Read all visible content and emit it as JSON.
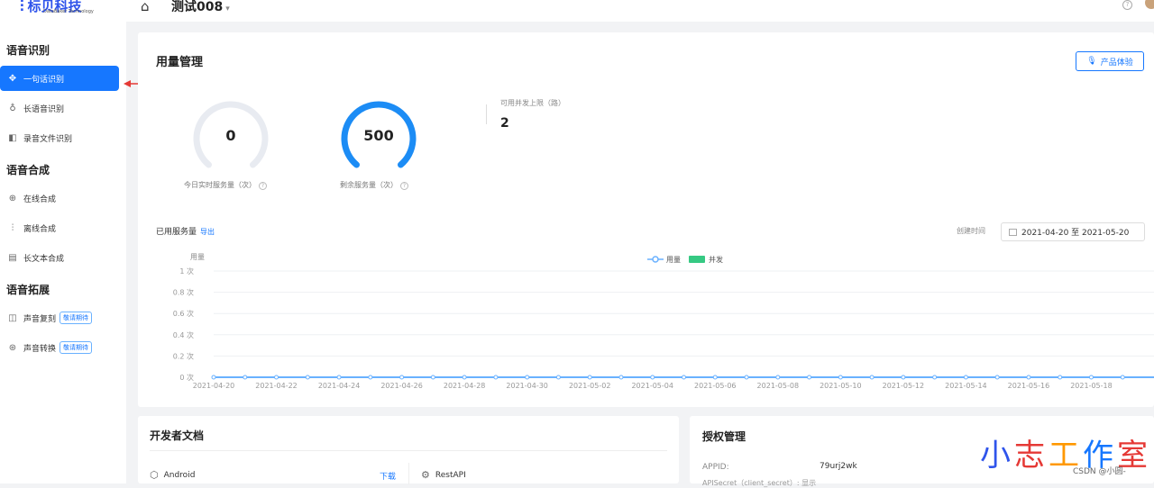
{
  "logo": {
    "name": "标贝科技",
    "sub": "DataBaker Technology"
  },
  "sidebar": {
    "sections": [
      {
        "title": "语音识别",
        "items": [
          {
            "label": "一句话识别",
            "icon": "waveform-icon"
          },
          {
            "label": "长语音识别",
            "icon": "mic-icon"
          },
          {
            "label": "录音文件识别",
            "icon": "audio-file-icon"
          }
        ]
      },
      {
        "title": "语音合成",
        "items": [
          {
            "label": "在线合成",
            "icon": "plus-circle-icon"
          },
          {
            "label": "离线合成",
            "icon": "wave-icon"
          },
          {
            "label": "长文本合成",
            "icon": "document-icon"
          }
        ]
      },
      {
        "title": "语音拓展",
        "items": [
          {
            "label": "声音复刻",
            "icon": "copy-icon",
            "tag": "敬请期待"
          },
          {
            "label": "声音转换",
            "icon": "convert-icon",
            "tag": "敬请期待"
          }
        ]
      }
    ]
  },
  "header": {
    "project": "测试008",
    "help": "?"
  },
  "usage": {
    "title": "用量管理",
    "try_button": "产品体验",
    "today_value": "0",
    "today_label": "今日实时服务量（次）",
    "remain_value": "500",
    "remain_label": "剩余服务量（次）",
    "remain_fraction": 1.0,
    "concurrency_label": "可用并发上限（路）",
    "concurrency_value": "2",
    "used_label": "已用服务量",
    "export": "导出",
    "date_label": "创建时间",
    "date_range": "2021-04-20 至 2021-05-20"
  },
  "chart_data": {
    "type": "line",
    "ylabel": "用量",
    "legend": [
      {
        "name": "用量",
        "color": "#69b1ff"
      },
      {
        "name": "并发",
        "color": "#36c983"
      }
    ],
    "y_ticks": [
      "1 次",
      "0.8 次",
      "0.6 次",
      "0.4 次",
      "0.2 次",
      "0 次"
    ],
    "ylim": [
      0,
      1
    ],
    "x": [
      "2021-04-20",
      "2021-04-21",
      "2021-04-22",
      "2021-04-23",
      "2021-04-24",
      "2021-04-25",
      "2021-04-26",
      "2021-04-27",
      "2021-04-28",
      "2021-04-29",
      "2021-04-30",
      "2021-05-01",
      "2021-05-02",
      "2021-05-03",
      "2021-05-04",
      "2021-05-05",
      "2021-05-06",
      "2021-05-07",
      "2021-05-08",
      "2021-05-09",
      "2021-05-10",
      "2021-05-11",
      "2021-05-12",
      "2021-05-13",
      "2021-05-14",
      "2021-05-15",
      "2021-05-16",
      "2021-05-17",
      "2021-05-18",
      "2021-05-19"
    ],
    "x_tick_labels": [
      "2021-04-20",
      "2021-04-22",
      "2021-04-24",
      "2021-04-26",
      "2021-04-28",
      "2021-04-30",
      "2021-05-02",
      "2021-05-04",
      "2021-05-06",
      "2021-05-08",
      "2021-05-10",
      "2021-05-12",
      "2021-05-14",
      "2021-05-16",
      "2021-05-18"
    ],
    "series": [
      {
        "name": "用量",
        "values": [
          0,
          0,
          0,
          0,
          0,
          0,
          0,
          0,
          0,
          0,
          0,
          0,
          0,
          0,
          0,
          0,
          0,
          0,
          0,
          0,
          0,
          0,
          0,
          0,
          0,
          0,
          0,
          0,
          0,
          0
        ]
      }
    ]
  },
  "docs": {
    "title": "开发者文档",
    "android": "Android",
    "download": "下载",
    "restapi": "RestAPI"
  },
  "auth": {
    "title": "授权管理",
    "appid_label": "APPID:",
    "appid_value": "79urj2wk",
    "secret_label": "APISecret（client_secret）: 显示"
  },
  "watermark": {
    "chars": [
      "小",
      "志",
      "工",
      "作",
      "室"
    ],
    "csdn": "CSDN @小圆-"
  },
  "colors": {
    "primary": "#1677ff",
    "gauge_track": "#e8ebf1",
    "concurrency": "#36c983"
  }
}
